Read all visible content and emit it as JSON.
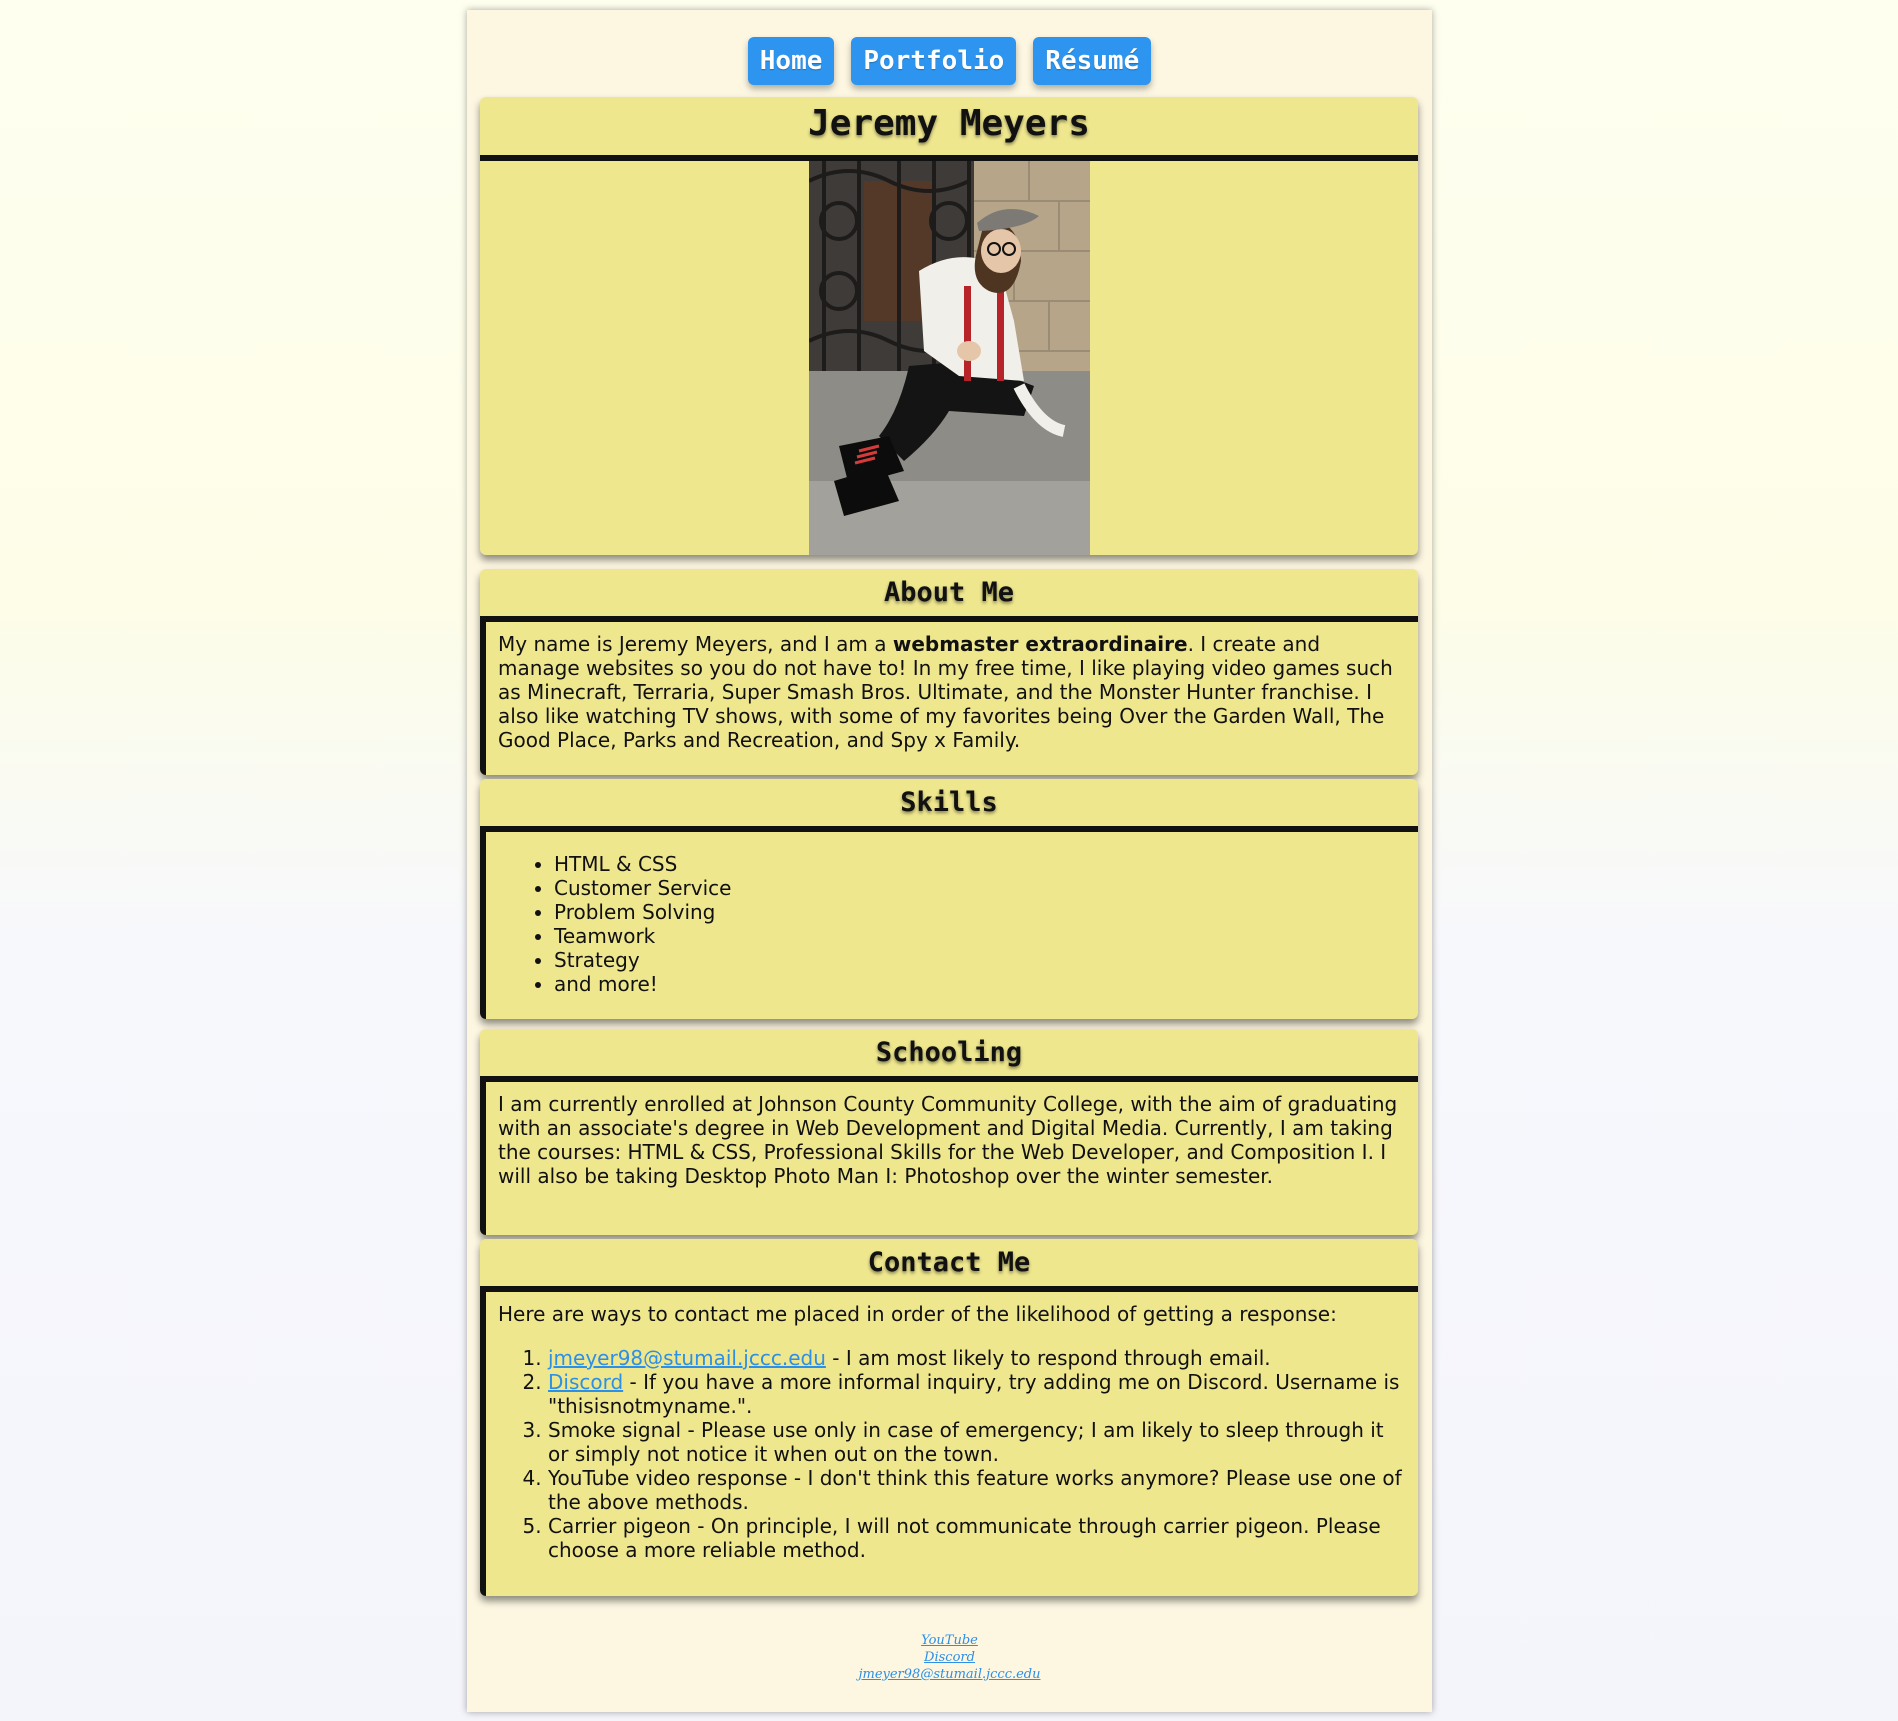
{
  "nav": {
    "items": [
      "Home",
      "Portfolio",
      "Résumé"
    ]
  },
  "hero": {
    "name": "Jeremy Meyers",
    "photo_alt": "Jeremy Meyers photo"
  },
  "about": {
    "heading": "About Me",
    "intro": "My name is Jeremy Meyers, and I am a ",
    "bold": "webmaster extraordinaire",
    "rest": ". I create and manage websites so you do not have to! In my free time, I like playing video games such as Minecraft, Terraria, Super Smash Bros. Ultimate, and the Monster Hunter franchise. I also like watching TV shows, with some of my favorites being Over the Garden Wall, The Good Place, Parks and Recreation, and Spy x Family."
  },
  "skills": {
    "heading": "Skills",
    "items": [
      "HTML & CSS",
      "Customer Service",
      "Problem Solving",
      "Teamwork",
      "Strategy",
      "and more!"
    ]
  },
  "schooling": {
    "heading": "Schooling",
    "text": "I am currently enrolled at Johnson County Community College, with the aim of graduating with an associate's degree in Web Development and Digital Media. Currently, I am taking the courses: HTML & CSS, Professional Skills for the Web Developer, and Composition I. I will also be taking Desktop Photo Man I: Photoshop over the winter semester."
  },
  "contact": {
    "heading": "Contact Me",
    "intro": "Here are ways to contact me placed in order of the likelihood of getting a response:",
    "items": [
      {
        "link": "jmeyer98@stumail.jccc.edu",
        "text": " - I am most likely to respond through email."
      },
      {
        "link": "Discord",
        "text": " - If you have a more informal inquiry, try adding me on Discord. Username is \"thisisnotmyname.\"."
      },
      {
        "link": "",
        "text": "Smoke signal - Please use only in case of emergency; I am likely to sleep through it or simply not notice it when out on the town."
      },
      {
        "link": "",
        "text": "YouTube video response - I don't think this feature works anymore? Please use one of the above methods."
      },
      {
        "link": "",
        "text": "Carrier pigeon - On principle, I will not communicate through carrier pigeon. Please choose a more reliable method."
      }
    ]
  },
  "footer": {
    "links": [
      "YouTube",
      "Discord",
      "jmeyer98@stumail.jccc.edu"
    ]
  }
}
